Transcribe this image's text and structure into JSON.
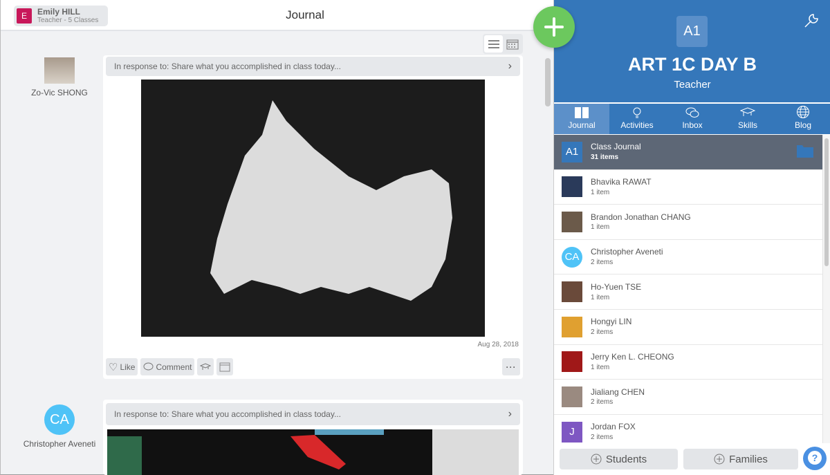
{
  "user": {
    "initial": "E",
    "name": "Emily HILL",
    "subtitle": "Teacher - 5 Classes",
    "avatar_color": "#c8185a"
  },
  "page_title": "Journal",
  "view_toggle": {
    "options": [
      "list-view",
      "calendar-view"
    ],
    "selected": "list-view"
  },
  "add_button": {
    "icon": "plus-icon",
    "color": "#6cc85e"
  },
  "posts": [
    {
      "author": "Zo-Vic SHONG",
      "response_to": "In response to: Share what you accomplished in class today...",
      "date": "Aug 28, 2018",
      "actions": {
        "like": "Like",
        "comment": "Comment"
      }
    },
    {
      "author": "Christopher Aveneti",
      "author_initials": "CA",
      "response_to": "In response to: Share what you accomplished in class today..."
    }
  ],
  "class": {
    "badge": "A1",
    "name": "ART 1C DAY B",
    "role": "Teacher",
    "header_color": "#3577ba"
  },
  "tabs": [
    {
      "label": "Journal",
      "icon": "book-icon",
      "active": true
    },
    {
      "label": "Activities",
      "icon": "lightbulb-icon",
      "active": false
    },
    {
      "label": "Inbox",
      "icon": "chat-bubbles-icon",
      "active": false
    },
    {
      "label": "Skills",
      "icon": "graduation-cap-icon",
      "active": false
    },
    {
      "label": "Blog",
      "icon": "globe-icon",
      "active": false
    }
  ],
  "students": [
    {
      "name": "Class Journal",
      "count": "31 items",
      "initials": "A1",
      "color": "#3577ba",
      "selected": true
    },
    {
      "name": "Bhavika RAWAT",
      "count": "1 item",
      "color": "#2a3a5a"
    },
    {
      "name": "Brandon Jonathan CHANG",
      "count": "1 item",
      "color": "#6b5a4a"
    },
    {
      "name": "Christopher Aveneti",
      "count": "2 items",
      "initials": "CA",
      "color": "#4fc3f7",
      "round": true
    },
    {
      "name": "Ho-Yuen TSE",
      "count": "1 item",
      "color": "#6a4a3a"
    },
    {
      "name": "Hongyi LIN",
      "count": "2 items",
      "color": "#e0a030"
    },
    {
      "name": "Jerry Ken L. CHEONG",
      "count": "1 item",
      "color": "#a01818"
    },
    {
      "name": "Jialiang CHEN",
      "count": "2 items",
      "color": "#9a8a80"
    },
    {
      "name": "Jordan FOX",
      "count": "2 items",
      "initials": "J",
      "color": "#7e57c2"
    }
  ],
  "bottom": {
    "students_label": "Students",
    "families_label": "Families"
  }
}
